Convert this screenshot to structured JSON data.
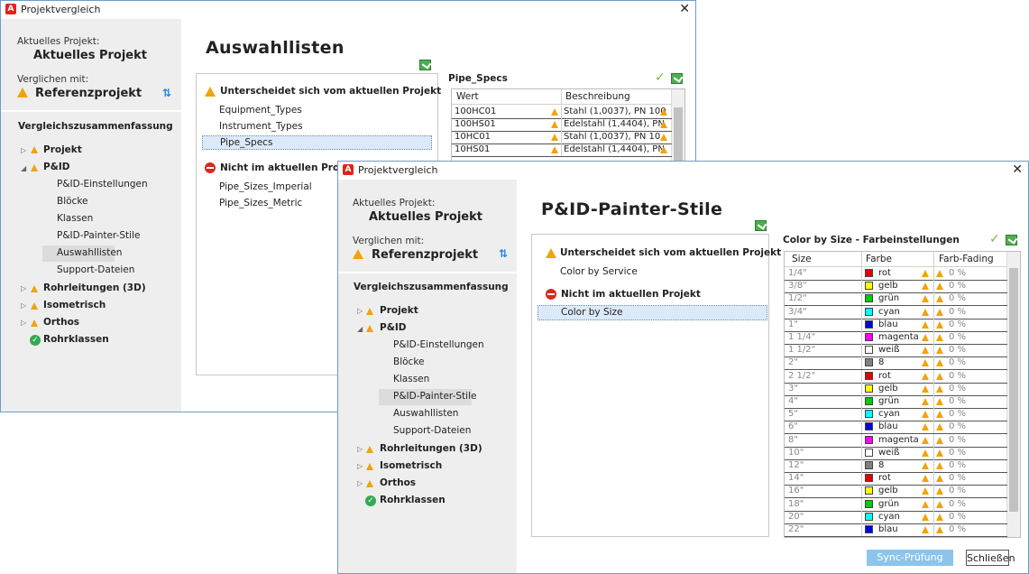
{
  "back_window": {
    "title": "Projektvergleich",
    "current_label": "Aktuelles Projekt:",
    "current_name": "Aktuelles Projekt",
    "compared_label": "Verglichen mit:",
    "compared_name": "Referenzprojekt",
    "summary_heading": "Vergleichszusammenfassung",
    "tree": [
      {
        "label": "Projekt"
      },
      {
        "label": "P&ID"
      },
      {
        "label": "P&ID-Einstellungen"
      },
      {
        "label": "Blöcke"
      },
      {
        "label": "Klassen"
      },
      {
        "label": "P&ID-Painter-Stile"
      },
      {
        "label": "Auswahllisten"
      },
      {
        "label": "Support-Dateien"
      },
      {
        "label": "Rohrleitungen (3D)"
      },
      {
        "label": "Isometrisch"
      },
      {
        "label": "Orthos"
      },
      {
        "label": "Rohrklassen"
      }
    ],
    "page_title": "Auswahllisten",
    "differs_heading": "Unterscheidet sich vom aktuellen Projekt",
    "differs_items": [
      "Equipment_Types",
      "Instrument_Types",
      "Pipe_Specs"
    ],
    "missing_heading": "Nicht im aktuellen Projekt",
    "missing_items": [
      "Pipe_Sizes_Imperial",
      "Pipe_Sizes_Metric"
    ],
    "detail_title": "Pipe_Specs",
    "columns": [
      "Wert",
      "Beschreibung"
    ],
    "rows": [
      {
        "wert": "100HC01",
        "beschreibung": "Stahl (1,0037), PN 100"
      },
      {
        "wert": "100HS01",
        "beschreibung": "Edelstahl (1,4404), PN"
      },
      {
        "wert": "10HC01",
        "beschreibung": "Stahl (1,0037), PN 10"
      },
      {
        "wert": "10HS01",
        "beschreibung": "Edelstahl (1,4404), PN"
      }
    ]
  },
  "front_window": {
    "title": "Projektvergleich",
    "current_label": "Aktuelles Projekt:",
    "current_name": "Aktuelles Projekt",
    "compared_label": "Verglichen mit:",
    "compared_name": "Referenzprojekt",
    "summary_heading": "Vergleichszusammenfassung",
    "tree": [
      {
        "label": "Projekt"
      },
      {
        "label": "P&ID"
      },
      {
        "label": "P&ID-Einstellungen"
      },
      {
        "label": "Blöcke"
      },
      {
        "label": "Klassen"
      },
      {
        "label": "P&ID-Painter-Stile"
      },
      {
        "label": "Auswahllisten"
      },
      {
        "label": "Support-Dateien"
      },
      {
        "label": "Rohrleitungen (3D)"
      },
      {
        "label": "Isometrisch"
      },
      {
        "label": "Orthos"
      },
      {
        "label": "Rohrklassen"
      }
    ],
    "page_title": "P&ID-Painter-Stile",
    "differs_heading": "Unterscheidet sich vom aktuellen Projekt",
    "differs_items": [
      "Color by Service"
    ],
    "missing_heading": "Nicht im aktuellen Projekt",
    "missing_items": [
      "Color by Size"
    ],
    "detail_title": "Color by Size  - Farbeinstellungen",
    "columns": [
      "Size",
      "Farbe",
      "Farb-Fading"
    ],
    "rows": [
      {
        "size": "1/4\"",
        "farbe": "rot",
        "color": "#e00000",
        "fading": "0 %"
      },
      {
        "size": "3/8\"",
        "farbe": "gelb",
        "color": "#ffff00",
        "fading": "0 %"
      },
      {
        "size": "1/2\"",
        "farbe": "grün",
        "color": "#00cc00",
        "fading": "0 %"
      },
      {
        "size": "3/4\"",
        "farbe": "cyan",
        "color": "#00ffff",
        "fading": "0 %"
      },
      {
        "size": "1\"",
        "farbe": "blau",
        "color": "#0000e0",
        "fading": "0 %"
      },
      {
        "size": "1 1/4\"",
        "farbe": "magenta",
        "color": "#ff00ff",
        "fading": "0 %"
      },
      {
        "size": "1 1/2\"",
        "farbe": "weiß",
        "color": "#ffffff",
        "fading": "0 %"
      },
      {
        "size": "2\"",
        "farbe": "8",
        "color": "#808080",
        "fading": "0 %"
      },
      {
        "size": "2 1/2\"",
        "farbe": "rot",
        "color": "#e00000",
        "fading": "0 %"
      },
      {
        "size": "3\"",
        "farbe": "gelb",
        "color": "#ffff00",
        "fading": "0 %"
      },
      {
        "size": "4\"",
        "farbe": "grün",
        "color": "#00cc00",
        "fading": "0 %"
      },
      {
        "size": "5\"",
        "farbe": "cyan",
        "color": "#00ffff",
        "fading": "0 %"
      },
      {
        "size": "6\"",
        "farbe": "blau",
        "color": "#0000e0",
        "fading": "0 %"
      },
      {
        "size": "8\"",
        "farbe": "magenta",
        "color": "#ff00ff",
        "fading": "0 %"
      },
      {
        "size": "10\"",
        "farbe": "weiß",
        "color": "#ffffff",
        "fading": "0 %"
      },
      {
        "size": "12\"",
        "farbe": "8",
        "color": "#808080",
        "fading": "0 %"
      },
      {
        "size": "14\"",
        "farbe": "rot",
        "color": "#e00000",
        "fading": "0 %"
      },
      {
        "size": "16\"",
        "farbe": "gelb",
        "color": "#ffff00",
        "fading": "0 %"
      },
      {
        "size": "18\"",
        "farbe": "grün",
        "color": "#00cc00",
        "fading": "0 %"
      },
      {
        "size": "20\"",
        "farbe": "cyan",
        "color": "#00ffff",
        "fading": "0 %"
      },
      {
        "size": "22\"",
        "farbe": "blau",
        "color": "#0000e0",
        "fading": "0 %"
      }
    ],
    "sync_button": "Sync-Prüfung",
    "close_button": "Schließen"
  },
  "icons": {
    "app": "autocad-plant-icon",
    "warning": "warning-icon",
    "missing": "no-entry-icon",
    "ok": "check-circle-icon",
    "sync": "sync-icon",
    "swap": "swap-arrows-icon",
    "close": "close-icon"
  },
  "colors": {
    "accent": "#1e88e5",
    "warning": "#f0a30a",
    "error": "#d9291c",
    "ok": "#34a853",
    "primary_button": "#8cc4ec"
  }
}
